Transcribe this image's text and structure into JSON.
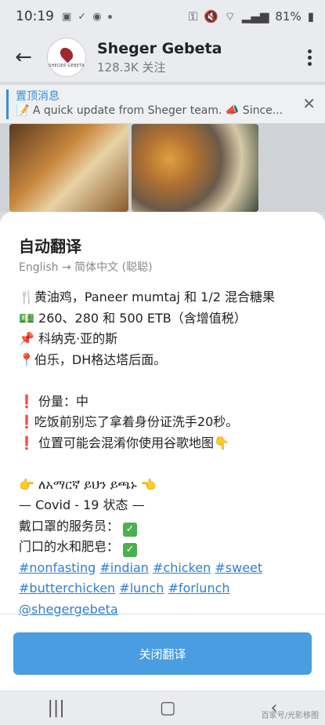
{
  "status": {
    "time": "10:19",
    "battery": "81%"
  },
  "header": {
    "back_icon": "arrow-left-icon",
    "channel_name": "Sheger Gebeta",
    "subscribers": "128.3K 关注",
    "avatar_text": "SHEGER GEBETA"
  },
  "pinned": {
    "title": "置顶消息",
    "text": "📝 A quick update from Sheger team. 📣 Since..."
  },
  "sheet": {
    "title": "自动翻译",
    "subtitle": "English → 简体中文 (聪聪)",
    "lines": [
      "🍴黄油鸡，Paneer mumtaj 和 1/2 混合糖果",
      "💵 260、280 和 500 ETB（含增值税）",
      "📌 科纳克·亚的斯",
      "📍伯乐，DH格达塔后面。",
      "",
      "份量：中",
      "吃饭前别忘了拿着身份证洗手20秒。",
      "位置可能会混淆你使用谷歌地图👇",
      "",
      "👉 ለአማርኛ ይህን ይጫኑ 👈",
      "— Covid - 19 状态 —",
      "戴口罩的服务员：",
      "门口的水和肥皂："
    ],
    "hashtags_line1": [
      "#nonfasting",
      "#indian",
      "#chicken",
      "#sweet"
    ],
    "hashtags_line2": [
      "#butterchicken",
      "#lunch",
      "#forlunch"
    ],
    "mention": "@shegergebeta",
    "close_button": "关闭翻译"
  },
  "watermark": "百家号/光影移图"
}
